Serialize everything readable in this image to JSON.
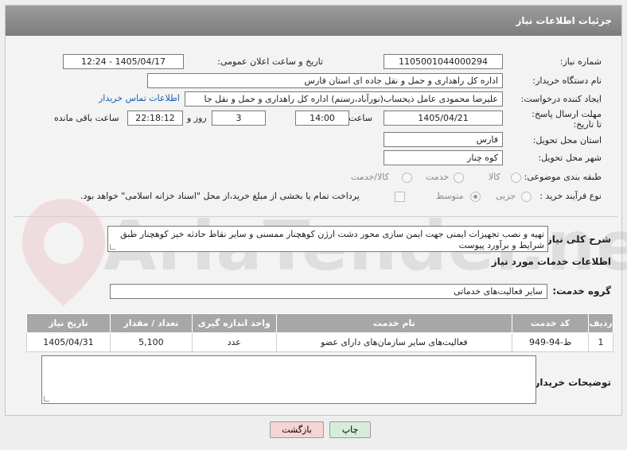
{
  "header": {
    "title": "جزئیات اطلاعات نیاز"
  },
  "fields": {
    "need_number_label": "شماره نیاز:",
    "need_number": "1105001044000294",
    "announce_label": "تاریخ و ساعت اعلان عمومی:",
    "announce_value": "1405/04/17 - 12:24",
    "buyer_org_label": "نام دستگاه خریدار:",
    "buyer_org": "اداره کل راهداری و حمل و نقل جاده ای استان فارس",
    "creator_label": "ایجاد کننده درخواست:",
    "creator": "علیرضا محمودی عامل ذیحساب(نورآباد،رستم) اداره کل راهداری و حمل و نقل جا",
    "contact_link": "اطلاعات تماس خریدار",
    "deadline_label": "مهلت ارسال پاسخ: تا تاریخ:",
    "deadline_date": "1405/04/21",
    "time_label": "ساعت",
    "deadline_time": "14:00",
    "days_value": "3",
    "days_label": "روز و",
    "remaining_time": "22:18:12",
    "remaining_label": "ساعت باقی مانده",
    "province_label": "استان محل تحویل:",
    "province": "فارس",
    "city_label": "شهر محل تحویل:",
    "city": "کوه چنار",
    "category_label": "طبقه بندی موضوعی:",
    "category_options": [
      "کالا",
      "خدمت",
      "کالا/خدمت"
    ],
    "purchase_type_label": "نوع فرآیند خرید :",
    "purchase_type_options": [
      "جزیی",
      "متوسط"
    ],
    "payment_note": "پرداخت تمام یا بخشی از مبلغ خرید،از محل \"اسناد خزانه اسلامی\" خواهد بود."
  },
  "description": {
    "label": "شرح کلی نیاز:",
    "text": "تهیه و نصب تجهیزات ایمنی جهت ایمن سازی محور دشت ارژن کوهچنار ممسنی و سایر نقاط حادثه خیز کوهچنار طبق شرایط و برآورد پیوست"
  },
  "services_title": "اطلاعات خدمات مورد نیاز",
  "service_group": {
    "label": "گروه خدمت:",
    "value": "سایر فعالیت‌های خدماتی"
  },
  "table": {
    "headers": [
      "ردیف",
      "کد خدمت",
      "نام خدمت",
      "واحد اندازه گیری",
      "تعداد / مقدار",
      "تاریخ نیاز"
    ],
    "rows": [
      [
        "1",
        "ط-94-949",
        "فعالیت‌های سایر سازمان‌های دارای عضو",
        "عدد",
        "5,100",
        "1405/04/31"
      ]
    ]
  },
  "buyer_notes": {
    "label": "توضیحات خریدار:",
    "value": ""
  },
  "buttons": {
    "print": "چاپ",
    "back": "بازگشت"
  },
  "watermark": "AriaTender.neT",
  "colors": {
    "header_bg": "#8c8c8c",
    "link": "#1a5fb4",
    "back_button": "#f7d4d4",
    "print_button": "#d9ecd9"
  }
}
